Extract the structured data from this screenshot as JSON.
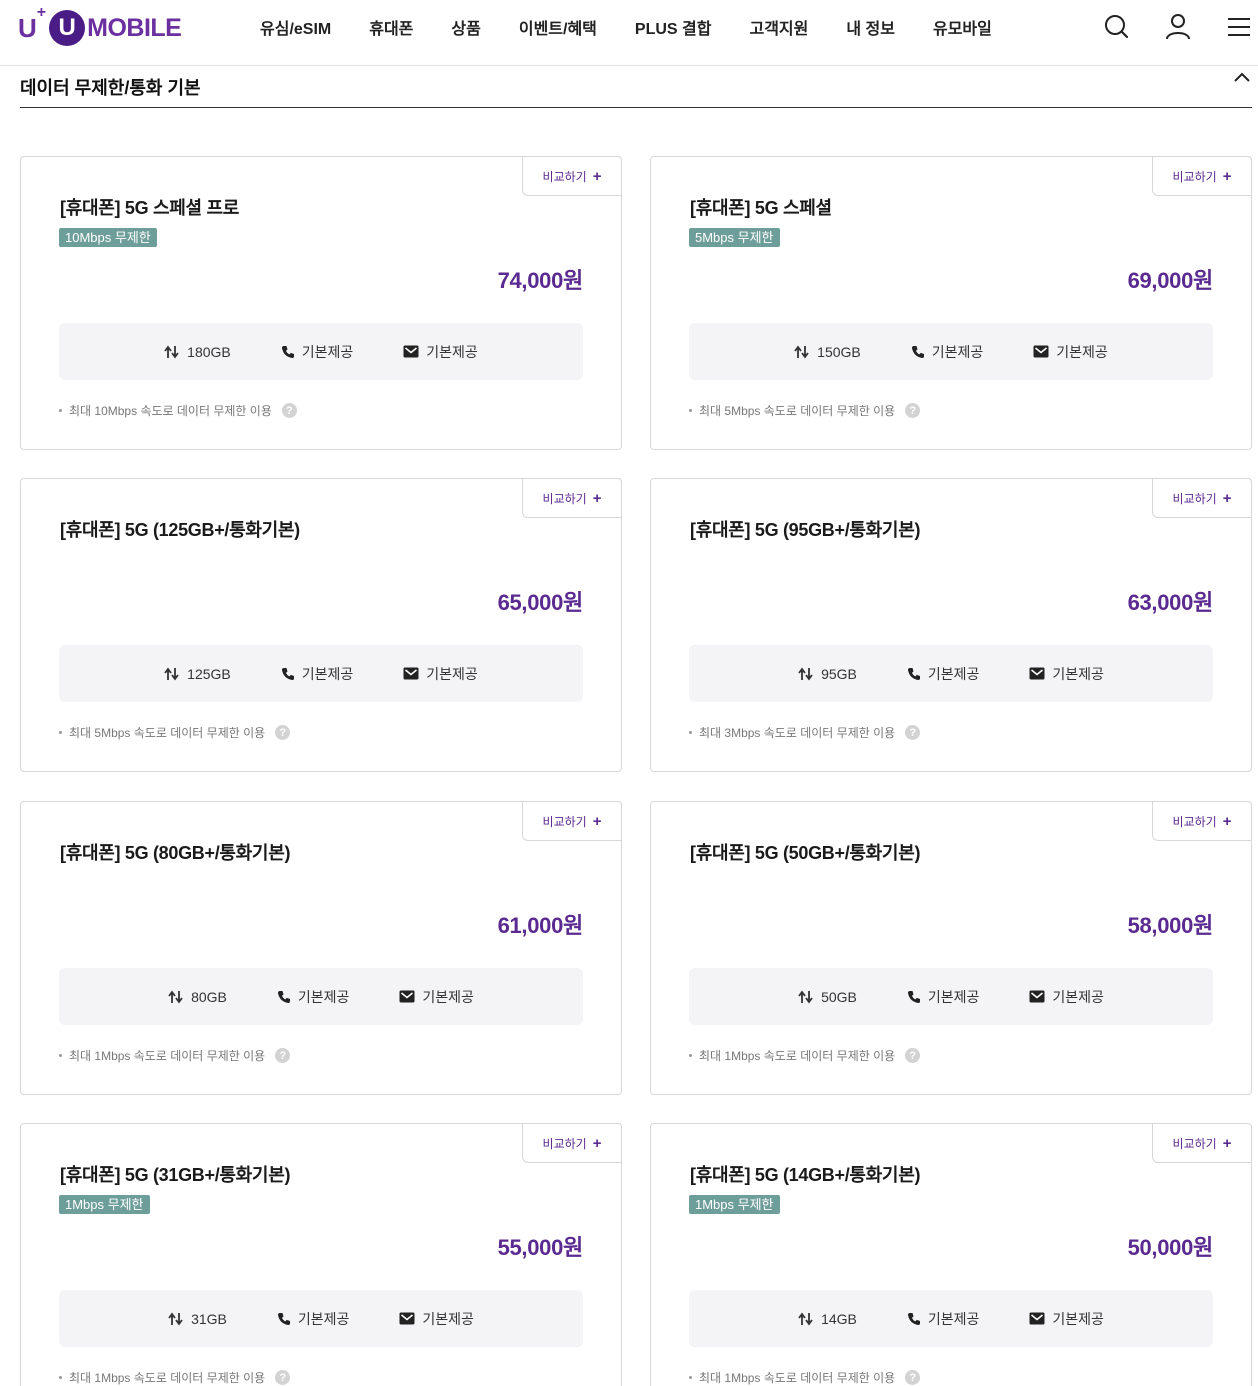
{
  "header": {
    "logo": {
      "u_plus": "U",
      "plus_mark": "+",
      "u_circle": "U",
      "mobile": "MOBILE"
    },
    "nav": [
      "유심/eSIM",
      "휴대폰",
      "상품",
      "이벤트/혜택",
      "PLUS 결합",
      "고객지원",
      "내 정보",
      "유모바일"
    ],
    "icons": [
      "search-icon",
      "user-icon",
      "menu-icon"
    ]
  },
  "section": {
    "title": "데이터 무제한/통화 기본"
  },
  "compare_label": "비교하기",
  "compare_plus": "+",
  "cards": [
    {
      "title": "[휴대폰] 5G 스페셜 프로",
      "badge": "10Mbps 무제한",
      "price": "74,000원",
      "data": "180GB",
      "call": "기본제공",
      "sms": "기본제공",
      "note": "최대 10Mbps 속도로 데이터 무제한 이용",
      "help": "?"
    },
    {
      "title": "[휴대폰] 5G 스페셜",
      "badge": "5Mbps 무제한",
      "price": "69,000원",
      "data": "150GB",
      "call": "기본제공",
      "sms": "기본제공",
      "note": "최대 5Mbps 속도로 데이터 무제한 이용",
      "help": "?"
    },
    {
      "title": "[휴대폰] 5G (125GB+/통화기본)",
      "badge": "",
      "price": "65,000원",
      "data": "125GB",
      "call": "기본제공",
      "sms": "기본제공",
      "note": "최대 5Mbps 속도로 데이터 무제한 이용",
      "help": "?"
    },
    {
      "title": "[휴대폰] 5G (95GB+/통화기본)",
      "badge": "",
      "price": "63,000원",
      "data": "95GB",
      "call": "기본제공",
      "sms": "기본제공",
      "note": "최대 3Mbps 속도로 데이터 무제한 이용",
      "help": "?"
    },
    {
      "title": "[휴대폰] 5G (80GB+/통화기본)",
      "badge": "",
      "price": "61,000원",
      "data": "80GB",
      "call": "기본제공",
      "sms": "기본제공",
      "note": "최대 1Mbps 속도로 데이터 무제한 이용",
      "help": "?"
    },
    {
      "title": "[휴대폰] 5G (50GB+/통화기본)",
      "badge": "",
      "price": "58,000원",
      "data": "50GB",
      "call": "기본제공",
      "sms": "기본제공",
      "note": "최대 1Mbps 속도로 데이터 무제한 이용",
      "help": "?"
    },
    {
      "title": "[휴대폰] 5G (31GB+/통화기본)",
      "badge": "1Mbps 무제한",
      "price": "55,000원",
      "data": "31GB",
      "call": "기본제공",
      "sms": "기본제공",
      "note": "최대 1Mbps 속도로 데이터 무제한 이용",
      "help": "?"
    },
    {
      "title": "[휴대폰] 5G (14GB+/통화기본)",
      "badge": "1Mbps 무제한",
      "price": "50,000원",
      "data": "14GB",
      "call": "기본제공",
      "sms": "기본제공",
      "note": "최대 1Mbps 속도로 데이터 무제한 이용",
      "help": "?"
    }
  ],
  "colors": {
    "brand": "#5b2a91",
    "badge": "#6e9e9a",
    "spec_bg": "#f4f4f6"
  }
}
